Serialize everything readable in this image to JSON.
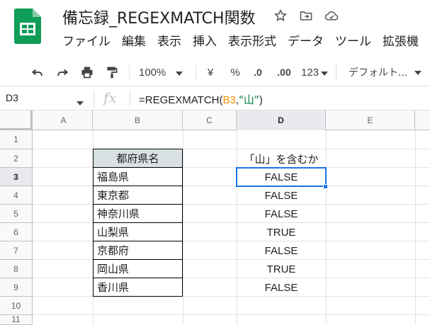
{
  "app": {
    "doc_title": "備忘録_REGEXMATCH関数",
    "menu": [
      "ファイル",
      "編集",
      "表示",
      "挿入",
      "表示形式",
      "データ",
      "ツール",
      "拡張機"
    ]
  },
  "toolbar": {
    "zoom": "100%",
    "currency": "¥",
    "percent": "%",
    "decimal_decrease": ".0",
    "decimal_increase": ".00",
    "number_format": "123",
    "font": "デフォルト..."
  },
  "formula_bar": {
    "cell_ref": "D3",
    "fx": "fx",
    "formula_prefix": "=REGEXMATCH(",
    "formula_ref": "B3",
    "formula_comma": ",",
    "formula_string": "\"山\"",
    "formula_suffix": ")"
  },
  "sheet": {
    "columns": [
      "A",
      "B",
      "C",
      "D",
      "E"
    ],
    "rows": [
      "1",
      "2",
      "3",
      "4",
      "5",
      "6",
      "7",
      "8",
      "9",
      "10",
      "11"
    ],
    "b_header": "都府県名",
    "d_header": "「山」を含むか",
    "prefectures": [
      "福島県",
      "東京都",
      "神奈川県",
      "山梨県",
      "京都府",
      "岡山県",
      "香川県"
    ],
    "results": [
      "FALSE",
      "FALSE",
      "FALSE",
      "TRUE",
      "FALSE",
      "TRUE",
      "FALSE"
    ],
    "selected_cell": "D3"
  },
  "colors": {
    "sheets_green": "#0f9d58",
    "header_fill": "#d9e1e2",
    "selection": "#1a73e8"
  }
}
